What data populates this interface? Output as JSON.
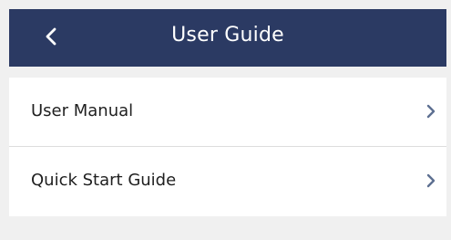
{
  "header": {
    "title": "User Guide",
    "back_icon": "chevron-left-icon",
    "background_color": "#2b3a63",
    "text_color": "#ffffff"
  },
  "menu": {
    "items": [
      {
        "label": "User Manual",
        "icon": "chevron-right-icon"
      },
      {
        "label": "Quick Start Guide",
        "icon": "chevron-right-icon"
      }
    ]
  },
  "colors": {
    "page_background": "#f0f0f0",
    "item_background": "#ffffff",
    "chevron": "#5d6f91"
  }
}
